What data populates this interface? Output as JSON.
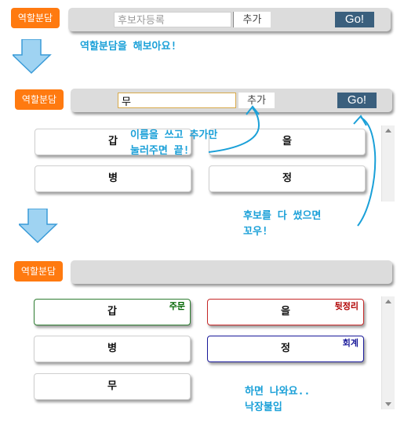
{
  "colors": {
    "tag": "#ff7a10",
    "go": "#3a5f7d",
    "note": "#1aa0d8",
    "cap": "#006400",
    "tidy": "#b00000",
    "acct": "#1a1a9a"
  },
  "panel1": {
    "tag": "역할분담",
    "input_value": "",
    "input_placeholder": "후보자등록",
    "add_label": "추가",
    "go_label": "Go!"
  },
  "note1": "역할분담을 해보아요!",
  "panel2": {
    "tag": "역할분담",
    "input_value": "무",
    "add_label": "추가",
    "go_label": "Go!",
    "cards": [
      "갑",
      "을",
      "병",
      "정"
    ]
  },
  "note2": {
    "line1": "이름을 쓰고 추가만",
    "line2": "눌러주면 끝!"
  },
  "note3": {
    "line1": "후보를 다 썼으면",
    "line2": "꼬우!"
  },
  "panel3": {
    "tag": "역할분담",
    "cards": [
      {
        "name": "갑",
        "role": "주문"
      },
      {
        "name": "을",
        "role": "뒷정리"
      },
      {
        "name": "병",
        "role": ""
      },
      {
        "name": "정",
        "role": "회계"
      },
      {
        "name": "무",
        "role": ""
      }
    ]
  },
  "note4": {
    "line1": "하면 나와요..",
    "line2": "낙장불입"
  }
}
